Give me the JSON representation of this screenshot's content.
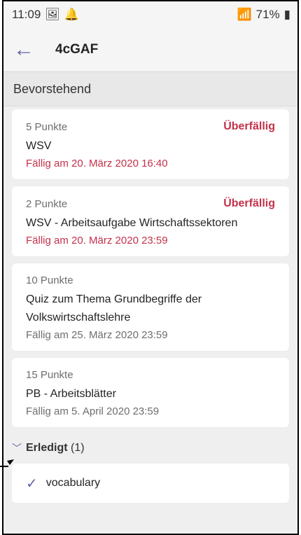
{
  "status_bar": {
    "time": "11:09",
    "battery": "71%"
  },
  "app_bar": {
    "title": "4cGAF"
  },
  "section": {
    "upcoming_label": "Bevorstehend"
  },
  "assignments": [
    {
      "points": "5 Punkte",
      "status": "Überfällig",
      "name": "WSV",
      "due": "Fällig am 20. März 2020 16:40"
    },
    {
      "points": "2 Punkte",
      "status": "Überfällig",
      "name": "WSV - Arbeitsaufgabe Wirtschaftssektoren",
      "due": "Fällig am 20. März 2020 23:59"
    },
    {
      "points": "10 Punkte",
      "status": "",
      "name": "Quiz zum Thema Grundbegriffe der Volkswirtschaftslehre",
      "due": "Fällig am 25. März 2020 23:59"
    },
    {
      "points": "15 Punkte",
      "status": "",
      "name": "PB - Arbeitsblätter",
      "due": "Fällig am 5. April 2020 23:59"
    }
  ],
  "completed": {
    "label": "Erledigt",
    "count": "(1)",
    "items": [
      {
        "name": "vocabulary"
      }
    ]
  },
  "colors": {
    "accent": "#6264a7",
    "overdue": "#c4314b"
  }
}
